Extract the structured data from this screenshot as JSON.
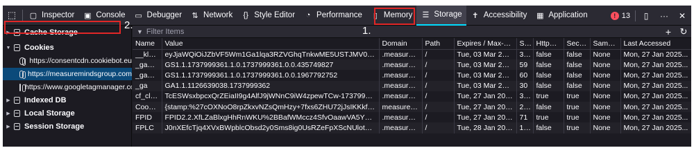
{
  "toolbar": {
    "tabs": [
      {
        "label": "Inspector",
        "icon": "inspector-icon",
        "glyph": "▢"
      },
      {
        "label": "Console",
        "icon": "console-icon",
        "glyph": "▣"
      },
      {
        "label": "Debugger",
        "icon": "debugger-icon",
        "glyph": "▭"
      },
      {
        "label": "Network",
        "icon": "network-icon",
        "glyph": "⇅"
      },
      {
        "label": "Style Editor",
        "icon": "style-editor-icon",
        "glyph": "{}"
      },
      {
        "label": "Performance",
        "icon": "performance-icon",
        "glyph": "◔"
      },
      {
        "label": "Memory",
        "icon": "memory-icon",
        "glyph": "▯"
      },
      {
        "label": "Storage",
        "icon": "storage-icon",
        "glyph": "☰"
      },
      {
        "label": "Accessibility",
        "icon": "accessibility-icon",
        "glyph": "✝"
      },
      {
        "label": "Application",
        "icon": "application-icon",
        "glyph": "▦"
      }
    ],
    "active_tab": "Storage",
    "error_count": "13",
    "error_glyph": "!",
    "dock_glyph": "▯",
    "more_glyph": "···",
    "close_glyph": "✕",
    "picker_glyph": "⬚"
  },
  "sidebar": {
    "items": [
      {
        "label": "Cache Storage",
        "expanded": false,
        "level": 0
      },
      {
        "label": "Cookies",
        "expanded": true,
        "level": 0
      },
      {
        "label": "https://consentcdn.cookiebot.eu",
        "level": 1
      },
      {
        "label": "https://measuremindsgroup.com",
        "level": 1,
        "selected": true
      },
      {
        "label": "https://www.googletagmanager.com",
        "level": 1
      },
      {
        "label": "Indexed DB",
        "expanded": false,
        "level": 0
      },
      {
        "label": "Local Storage",
        "expanded": false,
        "level": 0
      },
      {
        "label": "Session Storage",
        "expanded": false,
        "level": 0
      }
    ]
  },
  "filter": {
    "placeholder": "Filter Items",
    "add_glyph": "+",
    "refresh_glyph": "↻"
  },
  "table": {
    "columns": [
      "Name",
      "Value",
      "Domain",
      "Path",
      "Expires / Max-Age",
      "Size",
      "HttpOnly",
      "Secure",
      "SameSite",
      "Last Accessed"
    ],
    "rows": [
      [
        "__kla_id",
        "eyJjaWQiOiJZbVF5Wm1Ga1lqa3RZVGhqTnkwME5USTJMV0kxTVRFdE1...",
        ".measuremi...",
        "/",
        "Tue, 03 Mar 2026 ...",
        "388",
        "false",
        "false",
        "None",
        "Mon, 27 Jan 2025..."
      ],
      [
        "_ga_7W...",
        "GS1.1.1737999361.1.0.1737999361.0.0.435749827",
        ".measuremi...",
        "/",
        "Tue, 03 Mar 2026 ...",
        "59",
        "false",
        "false",
        "None",
        "Mon, 27 Jan 2025..."
      ],
      [
        "_ga_FH...",
        "GS1.1.1737999361.1.0.1737999361.0.0.1967792752",
        ".measuremi...",
        "/",
        "Tue, 03 Mar 2026 ...",
        "60",
        "false",
        "false",
        "None",
        "Mon, 27 Jan 2025..."
      ],
      [
        "_ga",
        "GA1.1.1126639038.1737999362",
        ".measuremi...",
        "/",
        "Tue, 03 Mar 2026 ...",
        "30",
        "false",
        "false",
        "None",
        "Mon, 27 Jan 2025..."
      ],
      [
        "cf_clear...",
        "TcESWsxbpcxQrZEiaII9g4AlfJ9jWNnC9iW4zpewTCw-1737999354-1.2....",
        ".measuremi...",
        "/",
        "Tue, 27 Jan 2026 ...",
        "374",
        "true",
        "true",
        "None",
        "Mon, 27 Jan 2025..."
      ],
      [
        "CookieC...",
        "{stamp:%27cOXNoO8rpZkxvNZsQmHzy+7fxs6ZHU72jJsIKKkfeJTg7xrj...",
        "measuremi...",
        "/",
        "Tue, 27 Jan 2026 ...",
        "225",
        "false",
        "true",
        "None",
        "Mon, 27 Jan 2025..."
      ],
      [
        "FPID",
        "FPID2.2.XfLZaBlxgHhRnWKU%2BBafWMccz4SfvOaawVA5YLestjl%3D.1...",
        ".measuremi...",
        "/",
        "Tue, 27 Jan 2026 ...",
        "71",
        "true",
        "true",
        "None",
        "Mon, 27 Jan 2025..."
      ],
      [
        "FPLC",
        "J0nXEfcTjq4XVxBWpblcObsd2y0Sms8ig0UsRZeFpXScNUlotJ%2FFMn...",
        ".measuremi...",
        "/",
        "Tue, 28 Jan 2025 ...",
        "140",
        "false",
        "true",
        "None",
        "Mon, 27 Jan 2025..."
      ]
    ]
  },
  "annotations": {
    "step1": "1.",
    "step2": "2.",
    "color": "#e22727"
  }
}
